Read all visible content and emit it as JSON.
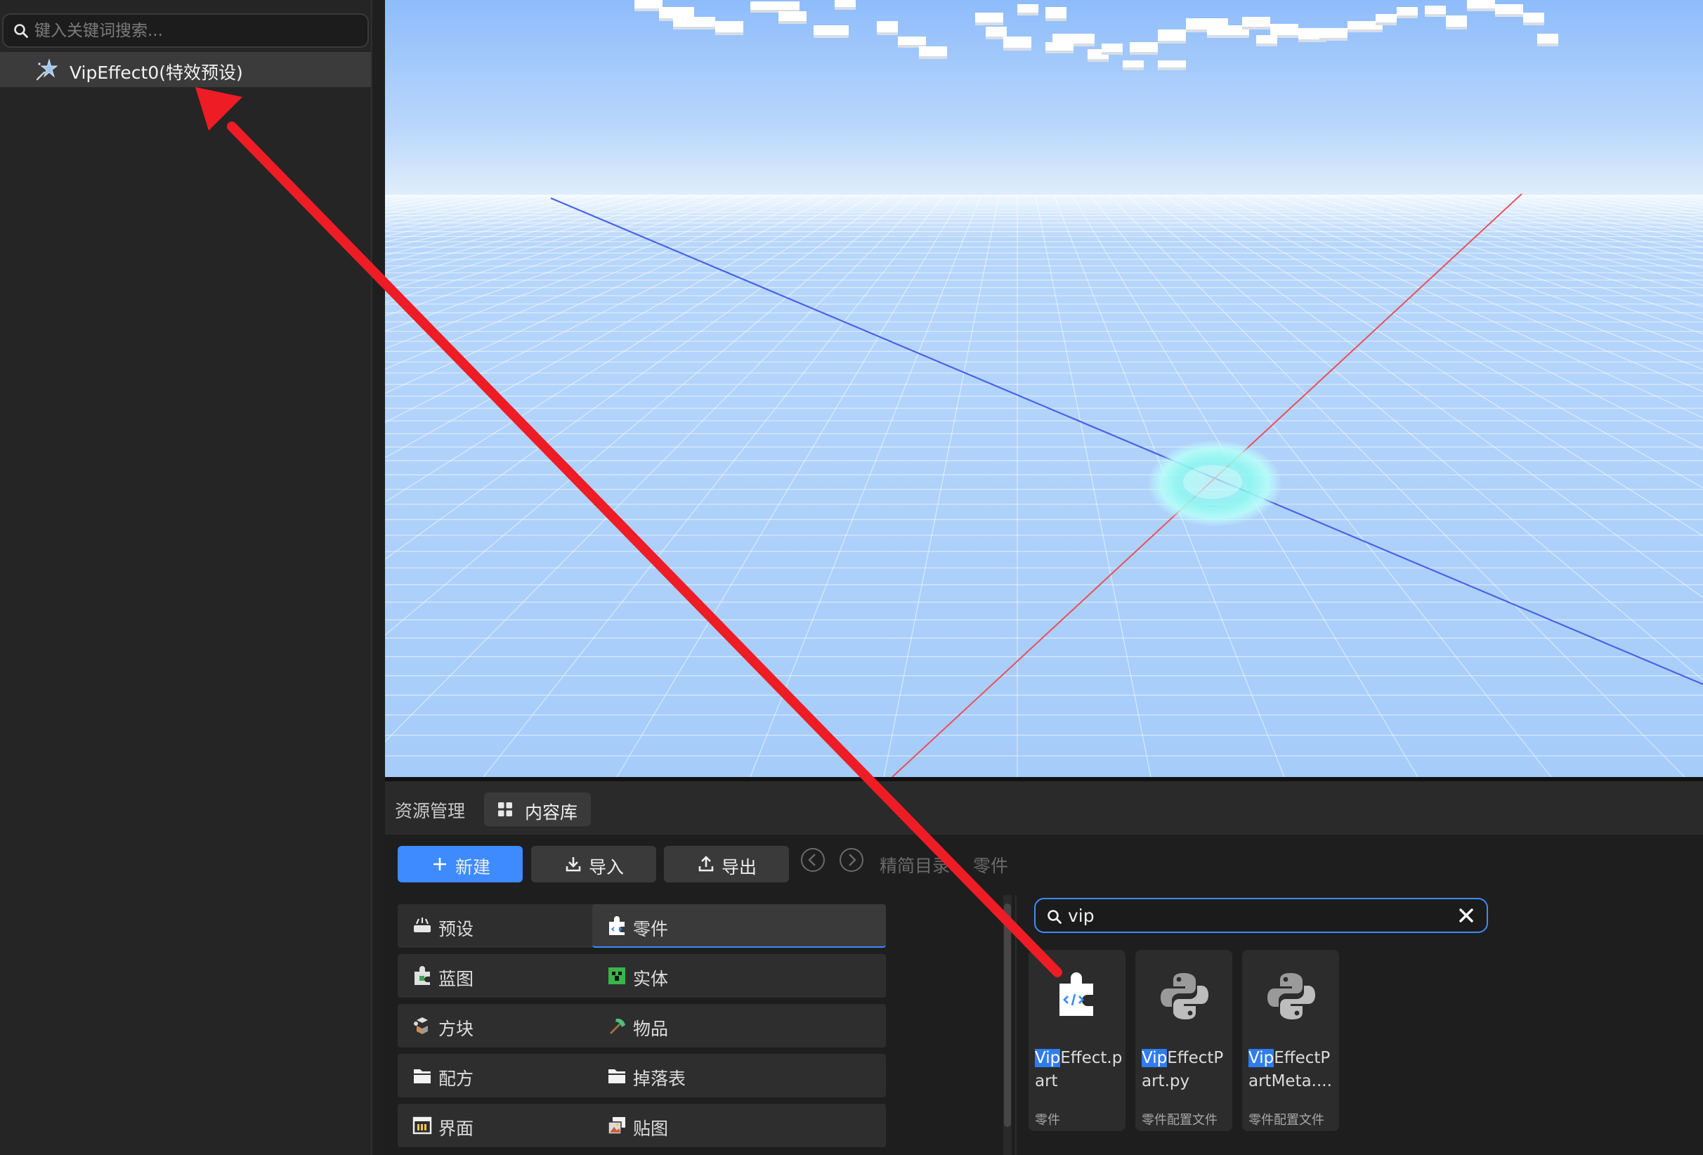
{
  "hierarchy": {
    "search_placeholder": "键入关键词搜索...",
    "items": [
      {
        "label": "VipEffect0(特效预设)",
        "icon": "effect-star-icon",
        "selected": true
      }
    ]
  },
  "viewport": {
    "sky_color": "#a9cefa",
    "axis_x_color": "#e9505a",
    "axis_z_color": "#4b62e6",
    "effect_color": "#7ff5f0"
  },
  "bottom_panel": {
    "tabs": [
      {
        "label": "资源管理",
        "active": false
      },
      {
        "label": "内容库",
        "active": true,
        "icon": "grid-icon"
      }
    ],
    "toolbar": {
      "new_label": "新建",
      "import_label": "导入",
      "export_label": "导出"
    },
    "breadcrumb": [
      "精简目录",
      "零件"
    ],
    "categories": [
      {
        "label": "预设",
        "icon": "preset-icon"
      },
      {
        "label": "零件",
        "icon": "part-icon",
        "active": true
      },
      {
        "label": "蓝图",
        "icon": "blueprint-icon"
      },
      {
        "label": "实体",
        "icon": "entity-icon"
      },
      {
        "label": "方块",
        "icon": "block-icon"
      },
      {
        "label": "物品",
        "icon": "item-icon"
      },
      {
        "label": "配方",
        "icon": "folder-icon"
      },
      {
        "label": "掉落表",
        "icon": "folder-icon"
      },
      {
        "label": "界面",
        "icon": "ui-icon"
      },
      {
        "label": "贴图",
        "icon": "texture-icon"
      }
    ],
    "asset_search": {
      "value": "vip"
    },
    "assets": [
      {
        "highlight": "Vip",
        "rest": "Effect.part",
        "type": "零件",
        "icon": "part-file-icon"
      },
      {
        "highlight": "Vip",
        "rest": "EffectPart.py",
        "type": "零件配置文件",
        "icon": "python-icon"
      },
      {
        "highlight": "Vip",
        "rest": "EffectPartMeta....",
        "type": "零件配置文件",
        "icon": "python-icon"
      }
    ]
  },
  "colors": {
    "accent": "#3d8bff",
    "annotation_arrow": "#ee1c25"
  }
}
